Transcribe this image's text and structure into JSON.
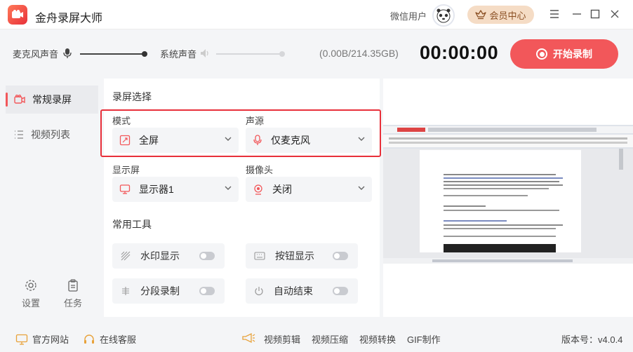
{
  "app": {
    "title": "金舟录屏大师",
    "user_name": "微信用户",
    "vip_label": "会员中心"
  },
  "toolbar": {
    "mic_label": "麦克风声音",
    "mic_level": 1.0,
    "system_label": "系统声音",
    "system_level": 0.0,
    "storage": "(0.00B/214.35GB)",
    "timer": "00:00:00",
    "start_label": "开始录制"
  },
  "sidebar": {
    "items": [
      {
        "label": "常规录屏",
        "active": true
      },
      {
        "label": "视频列表",
        "active": false
      }
    ],
    "settings_label": "设置",
    "tasks_label": "任务"
  },
  "panel": {
    "section_record": "录屏选择",
    "mode_label": "模式",
    "mode_value": "全屏",
    "audio_label": "声源",
    "audio_value": "仅麦克风",
    "display_label": "显示屏",
    "display_value": "显示器1",
    "camera_label": "摄像头",
    "camera_value": "关闭",
    "section_tools": "常用工具",
    "tools": [
      {
        "label": "水印显示",
        "enabled": false
      },
      {
        "label": "按钮显示",
        "enabled": false
      },
      {
        "label": "分段录制",
        "enabled": false
      },
      {
        "label": "自动结束",
        "enabled": false
      }
    ]
  },
  "footer": {
    "website": "官方网站",
    "support": "在线客服",
    "video_edit": "视频剪辑",
    "video_compress": "视频压缩",
    "video_convert": "视频转换",
    "gif": "GIF制作",
    "version": "版本号：v4.0.4"
  },
  "colors": {
    "accent": "#f2575a",
    "highlight": "#e8303a",
    "vip_bg": "#f5dcc5"
  }
}
